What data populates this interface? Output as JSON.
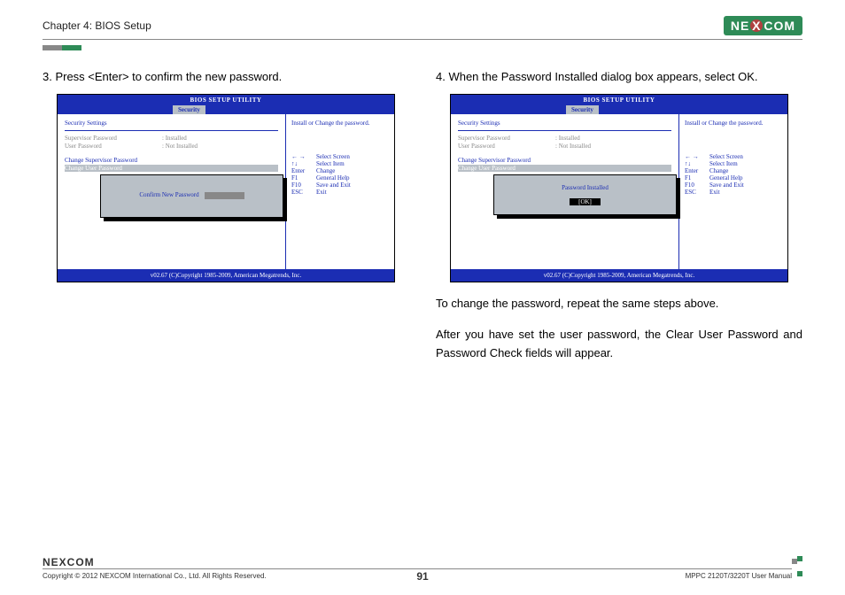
{
  "header": {
    "chapter": "Chapter 4: BIOS Setup",
    "logo_text_left": "NE",
    "logo_x": "X",
    "logo_text_right": "COM"
  },
  "left": {
    "step": "3.  Press <Enter> to confirm the new password.",
    "bios": {
      "title": "BIOS SETUP UTILITY",
      "tab": "Security",
      "section": "Security Settings",
      "rows": [
        {
          "label": "Supervisor Password",
          "value": ": Installed"
        },
        {
          "label": "User Password",
          "value": ": Not Installed"
        }
      ],
      "action1": "Change Supervisor Password",
      "action2": "Change User Password",
      "dialog_label": "Confirm New Password",
      "hint": "Install or Change the password.",
      "help": [
        {
          "k": "← →",
          "v": "Select Screen"
        },
        {
          "k": "↑↓",
          "v": "Select Item"
        },
        {
          "k": "Enter",
          "v": "Change"
        },
        {
          "k": "F1",
          "v": "General Help"
        },
        {
          "k": "F10",
          "v": "Save and Exit"
        },
        {
          "k": "ESC",
          "v": "Exit"
        }
      ],
      "footer": "v02.67 (C)Copyright 1985-2009, American Megatrends, Inc."
    }
  },
  "right": {
    "step": "4.  When the Password Installed dialog box appears, select OK.",
    "bios": {
      "title": "BIOS SETUP UTILITY",
      "tab": "Security",
      "section": "Security Settings",
      "rows": [
        {
          "label": "Supervisor Password",
          "value": ": Installed"
        },
        {
          "label": "User Password",
          "value": ": Not Installed"
        }
      ],
      "action1": "Change Supervisor Password",
      "action2": "Change User Password",
      "dialog_label": "Password Installed",
      "ok": "[OK]",
      "hint": "Install or Change the password.",
      "help": [
        {
          "k": "← →",
          "v": "Select Screen"
        },
        {
          "k": "↑↓",
          "v": "Select Item"
        },
        {
          "k": "Enter",
          "v": "Change"
        },
        {
          "k": "F1",
          "v": "General Help"
        },
        {
          "k": "F10",
          "v": "Save and Exit"
        },
        {
          "k": "ESC",
          "v": "Exit"
        }
      ],
      "footer": "v02.67 (C)Copyright 1985-2009, American Megatrends, Inc."
    },
    "post1": "To change the password, repeat the same steps above.",
    "post2": "After you have set the user password, the Clear User Password and Password Check fields will appear."
  },
  "footer": {
    "logo": "NEXCOM",
    "copyright": "Copyright © 2012 NEXCOM International Co., Ltd. All Rights Reserved.",
    "page": "91",
    "manual": "MPPC 2120T/3220T User Manual"
  }
}
